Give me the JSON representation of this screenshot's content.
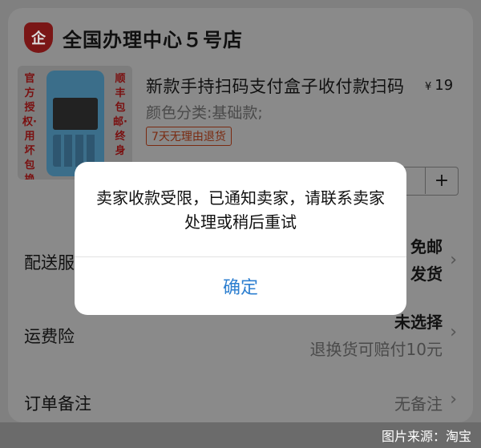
{
  "store": {
    "logo_text": "企",
    "name": "全国办理中心５号店"
  },
  "product": {
    "image_side_left": "官方授权·用坏包换",
    "image_side_right": "顺丰包邮·终身",
    "title": "新款手持扫码支付盒子收付款扫码",
    "price_currency": "¥",
    "price": "19",
    "variant": "颜色分类:基础款;",
    "badge": "7天无理由退货",
    "qty_plus": "+"
  },
  "rows": {
    "delivery_label": "配送服",
    "delivery_value_1": "免邮",
    "delivery_value_2": "发货",
    "insurance_label": "运费险",
    "insurance_value": "未选择",
    "insurance_sub": "退换货可赔付10元",
    "note_label": "订单备注",
    "note_value": "无备注"
  },
  "modal": {
    "message": "卖家收款受限，已通知卖家，请联系卖家处理或稍后重试",
    "confirm_label": "确定"
  },
  "source": {
    "label": "图片来源：淘宝"
  },
  "colors": {
    "overlay_bg": "#808080",
    "accent_blue": "#2d7fd0",
    "modal_bg": "#ffffff"
  }
}
